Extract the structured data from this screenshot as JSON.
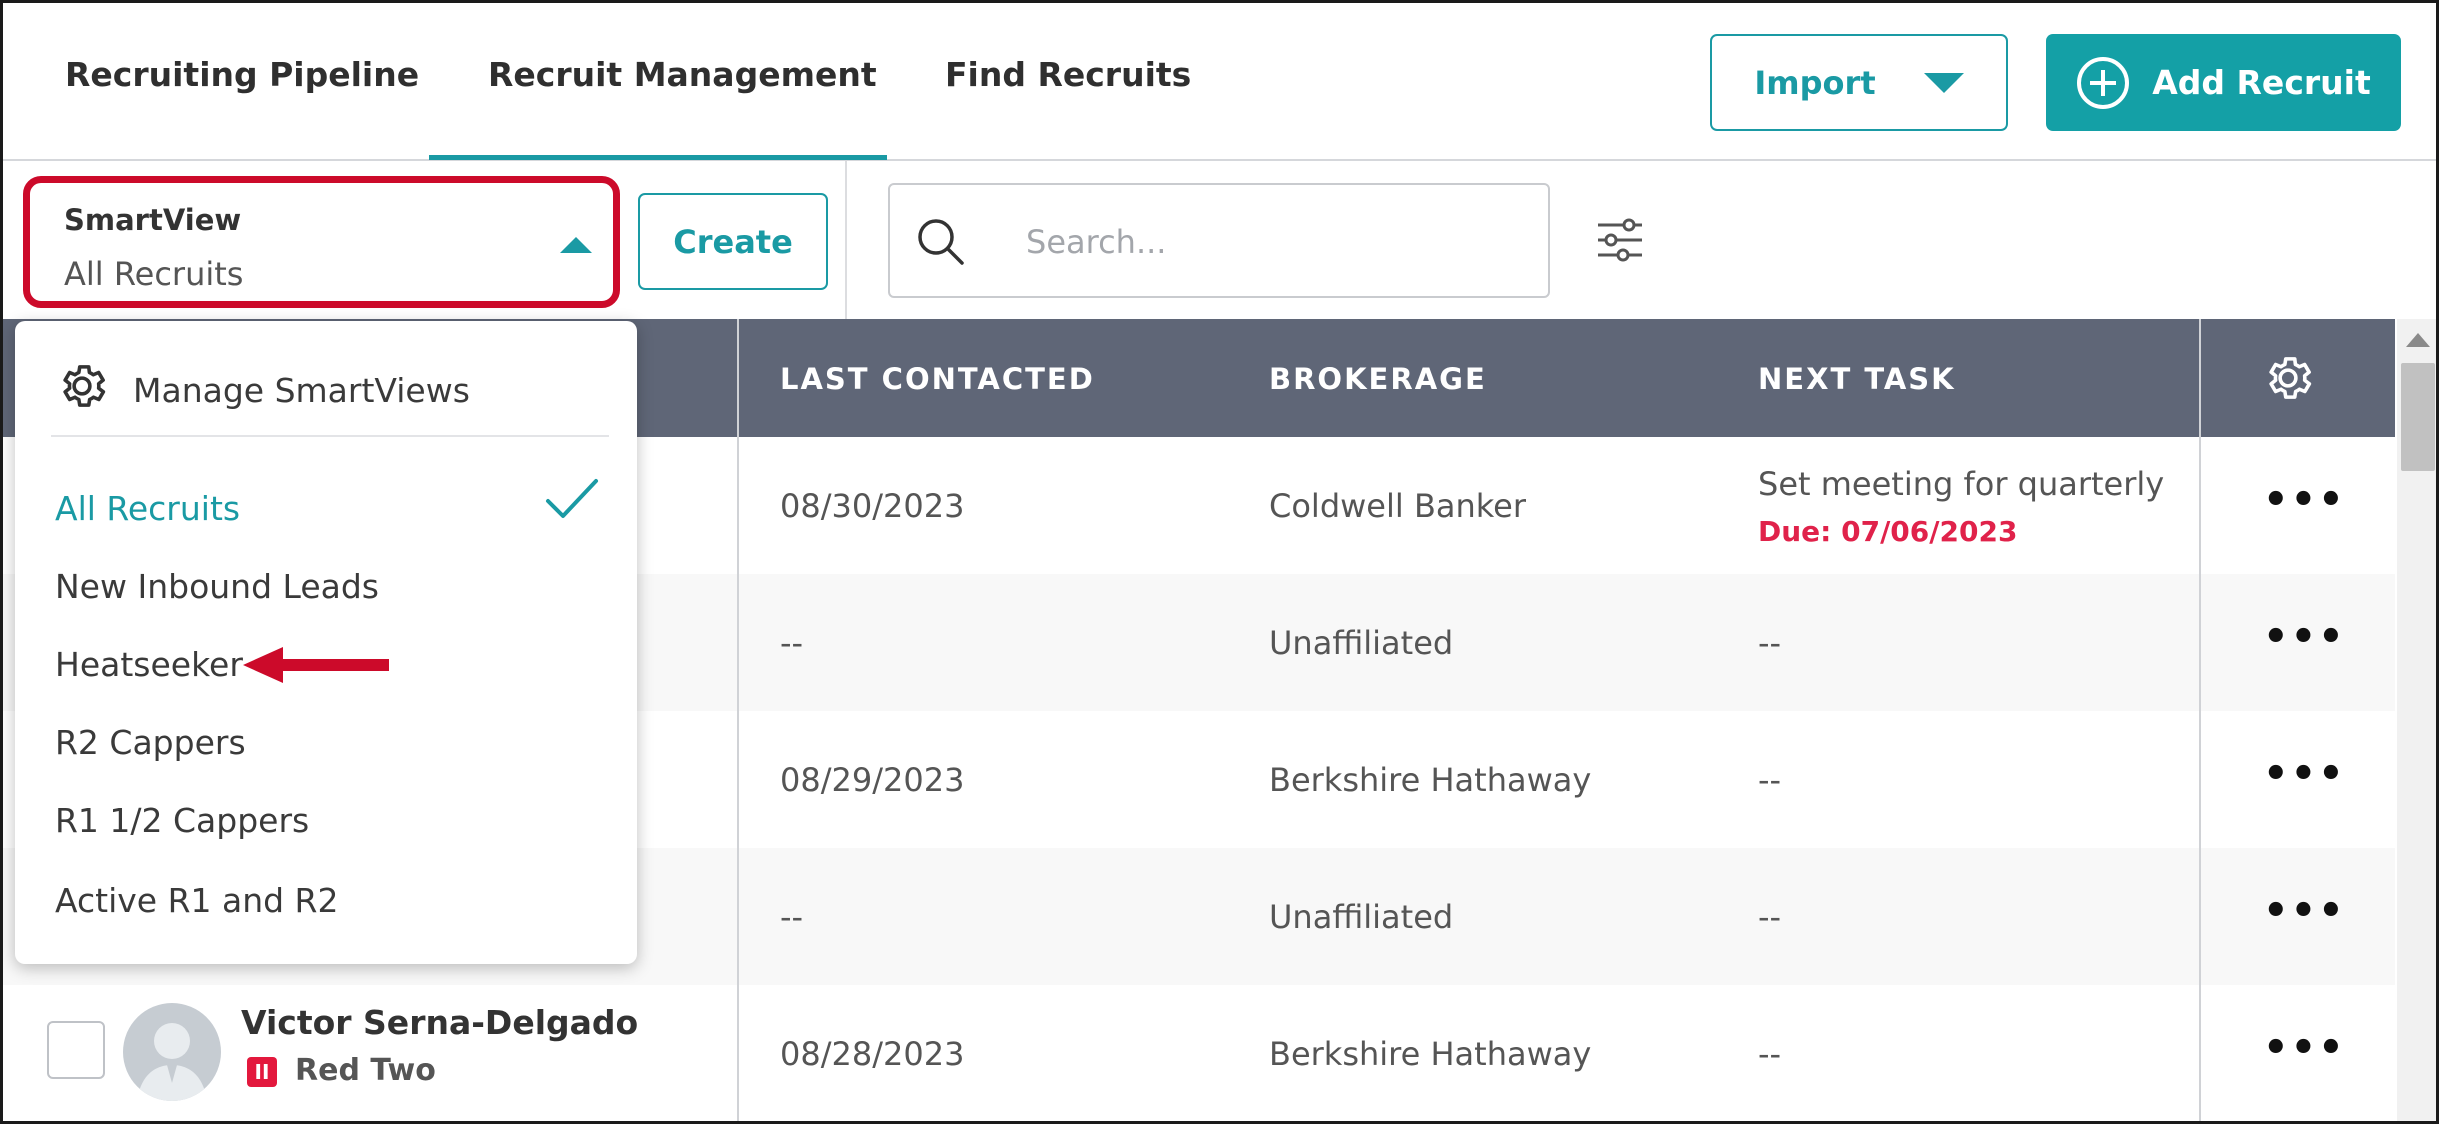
{
  "nav": {
    "tabs": [
      {
        "label": "Recruiting Pipeline"
      },
      {
        "label": "Recruit Management"
      },
      {
        "label": "Find Recruits"
      }
    ],
    "import_label": "Import",
    "add_recruit_label": "Add Recruit"
  },
  "toolbar": {
    "smartview_label": "SmartView",
    "smartview_value": "All Recruits",
    "create_label": "Create",
    "search_placeholder": "Search..."
  },
  "table": {
    "columns": [
      "LAST CONTACTED",
      "BROKERAGE",
      "NEXT TASK"
    ],
    "rows": [
      {
        "last_contacted": "08/30/2023",
        "brokerage": "Coldwell Banker",
        "next_task": "Set meeting for quarterly t",
        "due": "Due: 07/06/2023"
      },
      {
        "last_contacted": "--",
        "brokerage": "Unaffiliated",
        "next_task": "--",
        "due": ""
      },
      {
        "last_contacted": "08/29/2023",
        "brokerage": "Berkshire Hathaway",
        "next_task": "--",
        "due": ""
      },
      {
        "last_contacted": "--",
        "brokerage": "Unaffiliated",
        "next_task": "--",
        "due": ""
      },
      {
        "last_contacted": "08/28/2023",
        "brokerage": "Berkshire Hathaway",
        "next_task": "--",
        "due": "",
        "name": "Victor Serna-Delgado",
        "level": "Red Two"
      }
    ],
    "more_label": "•••"
  },
  "dropdown": {
    "manage_label": "Manage SmartViews",
    "items": [
      {
        "label": "All Recruits",
        "selected": true
      },
      {
        "label": "New Inbound Leads"
      },
      {
        "label": "Heatseeker"
      },
      {
        "label": "R2 Cappers"
      },
      {
        "label": "R1 1/2 Cappers"
      },
      {
        "label": "Active R1 and R2"
      }
    ]
  },
  "colors": {
    "accent": "#14a0a6",
    "highlight": "#cc0a2a",
    "header_bg": "#5f6677",
    "due_red": "#e0224a"
  }
}
